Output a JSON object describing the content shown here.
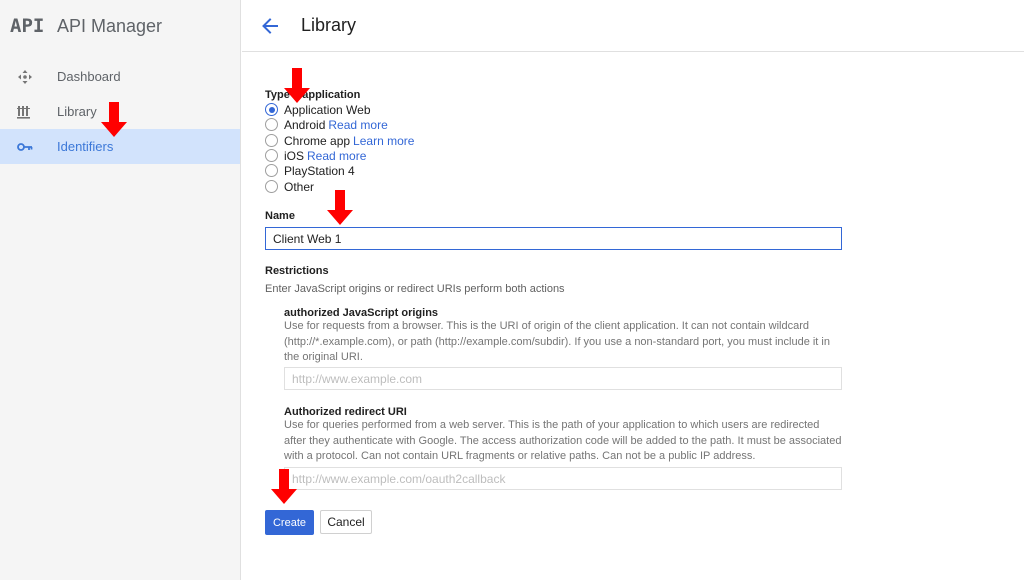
{
  "brand": {
    "logo": "API",
    "title": "API Manager"
  },
  "sidebar": {
    "items": [
      {
        "label": "Dashboard",
        "icon": "dashboard-icon"
      },
      {
        "label": "Library",
        "icon": "library-icon"
      },
      {
        "label": "Identifiers",
        "icon": "key-icon",
        "active": true
      }
    ]
  },
  "header": {
    "title": "Library",
    "back_icon": "back-arrow-icon"
  },
  "form": {
    "type_label": "Type d'application",
    "types": [
      {
        "label": "Application Web",
        "link": "",
        "checked": true
      },
      {
        "label": "Android",
        "link": "Read more",
        "checked": false
      },
      {
        "label": "Chrome app",
        "link": "Learn more",
        "checked": false
      },
      {
        "label": "iOS",
        "link": "Read more",
        "checked": false
      },
      {
        "label": "PlayStation 4",
        "link": "",
        "checked": false
      },
      {
        "label": "Other",
        "link": "",
        "checked": false
      }
    ],
    "name_label": "Name",
    "name_value": "Client Web 1",
    "restrictions_label": "Restrictions",
    "restrictions_desc": "Enter JavaScript origins or redirect URIs perform both actions",
    "origins_label": "authorized JavaScript origins",
    "origins_desc": "Use for requests from a browser. This is the URI of origin of the client application. It can not contain wildcard (http://*.example.com), or path (http://example.com/subdir). If you use a non-standard port, you must include it in the original URI.",
    "origins_placeholder": "http://www.example.com",
    "redirect_label": "Authorized redirect URI",
    "redirect_desc": "Use for queries performed from a web server. This is the path of your application to which users are redirected after they authenticate with Google. The access authorization code will be added to the path. It must be associated with a protocol. Can not contain URL fragments or relative paths. Can not be a public IP address.",
    "redirect_placeholder": "http://www.example.com/oauth2callback",
    "create_label": "Create",
    "cancel_label": "Cancel"
  },
  "colors": {
    "accent": "#3367d6",
    "active_bg": "#d2e3fc",
    "arrow": "#ff0000"
  }
}
